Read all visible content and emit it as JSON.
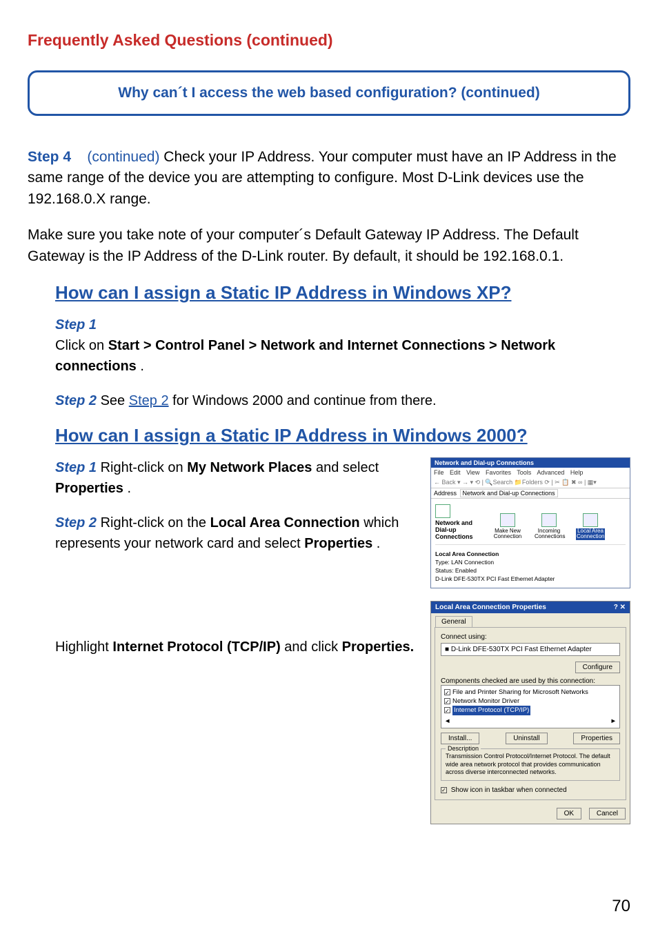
{
  "pageTitle": "Frequently Asked Questions (continued)",
  "questionBox": "Why can´t I access the web based configuration? (continued)",
  "step4": {
    "label": "Step 4",
    "continued": "(continued)",
    "text": " Check your IP Address. Your computer must have an IP Address in the same range of the device you are attempting to configure. Most D-Link devices use the 192.168.0.X range."
  },
  "gatewayNote": "Make sure you take note of your computer´s Default Gateway IP Address. The Default Gateway is the IP Address of the D-Link router. By default, it should be 192.168.0.1.",
  "headingXP": "How can I assign a Static IP Address in Windows XP?",
  "xp": {
    "step1Label": "Step 1",
    "step1a": "Click on ",
    "step1b": "Start > Control Panel > Network and Internet Connections > Network connections",
    "step1c": ".",
    "step2Label": "Step 2",
    "step2a": " See ",
    "step2link": "Step 2",
    "step2b": " for Windows 2000 and continue from there."
  },
  "heading2000": "How can I assign a Static IP Address in Windows 2000?",
  "w2k": {
    "s1Label": "Step 1",
    "s1a": " Right-click on ",
    "s1b": "My Network Places",
    "s1c": " and select ",
    "s1d": "Properties",
    "s1e": ".",
    "s2Label": "Step 2",
    "s2a": " Right-click on the ",
    "s2b": "Local Area Connection",
    "s2c": " which represents your network card and select ",
    "s2d": "Properties",
    "s2e": ".",
    "highlightA": "Highlight ",
    "highlightB": "Internet Protocol (TCP/IP)",
    "highlightC": " and click ",
    "highlightD": "Properties.",
    "highlightE": ""
  },
  "shot1": {
    "title": "Network and Dial-up Connections",
    "menu": [
      "File",
      "Edit",
      "View",
      "Favorites",
      "Tools",
      "Advanced",
      "Help"
    ],
    "toolbar": "← Back ▾  →  ▾  ⟲  | 🔍Search  📁Folders  ⟳  | ✂ 📋 ✖ ∞ | ▦▾",
    "addrLabel": "Address",
    "addrVal": "Network and Dial-up Connections",
    "mainLabel": "Network and Dial-up Connections",
    "icons": [
      "Make New Connection",
      "Incoming Connections",
      "Local Area Connection"
    ],
    "details": {
      "hd": "Local Area Connection",
      "type": "Type: LAN Connection",
      "status": "Status: Enabled",
      "adapter": "D-Link DFE-530TX PCI Fast Ethernet Adapter"
    }
  },
  "shot2": {
    "title": "Local Area Connection Properties",
    "closeglyphs": "?  ✕",
    "tab": "General",
    "connectUsing": "Connect using:",
    "adapter": "D-Link DFE-530TX PCI Fast Ethernet Adapter",
    "configure": "Configure",
    "compLabel": "Components checked are used by this connection:",
    "items": [
      "File and Printer Sharing for Microsoft Networks",
      "Network Monitor Driver",
      "Internet Protocol (TCP/IP)"
    ],
    "install": "Install...",
    "uninstall": "Uninstall",
    "properties": "Properties",
    "descLegend": "Description",
    "descText": "Transmission Control Protocol/Internet Protocol. The default wide area network protocol that provides communication across diverse interconnected networks.",
    "showIcon": "Show icon in taskbar when connected",
    "ok": "OK",
    "cancel": "Cancel"
  },
  "pageNumber": "70"
}
